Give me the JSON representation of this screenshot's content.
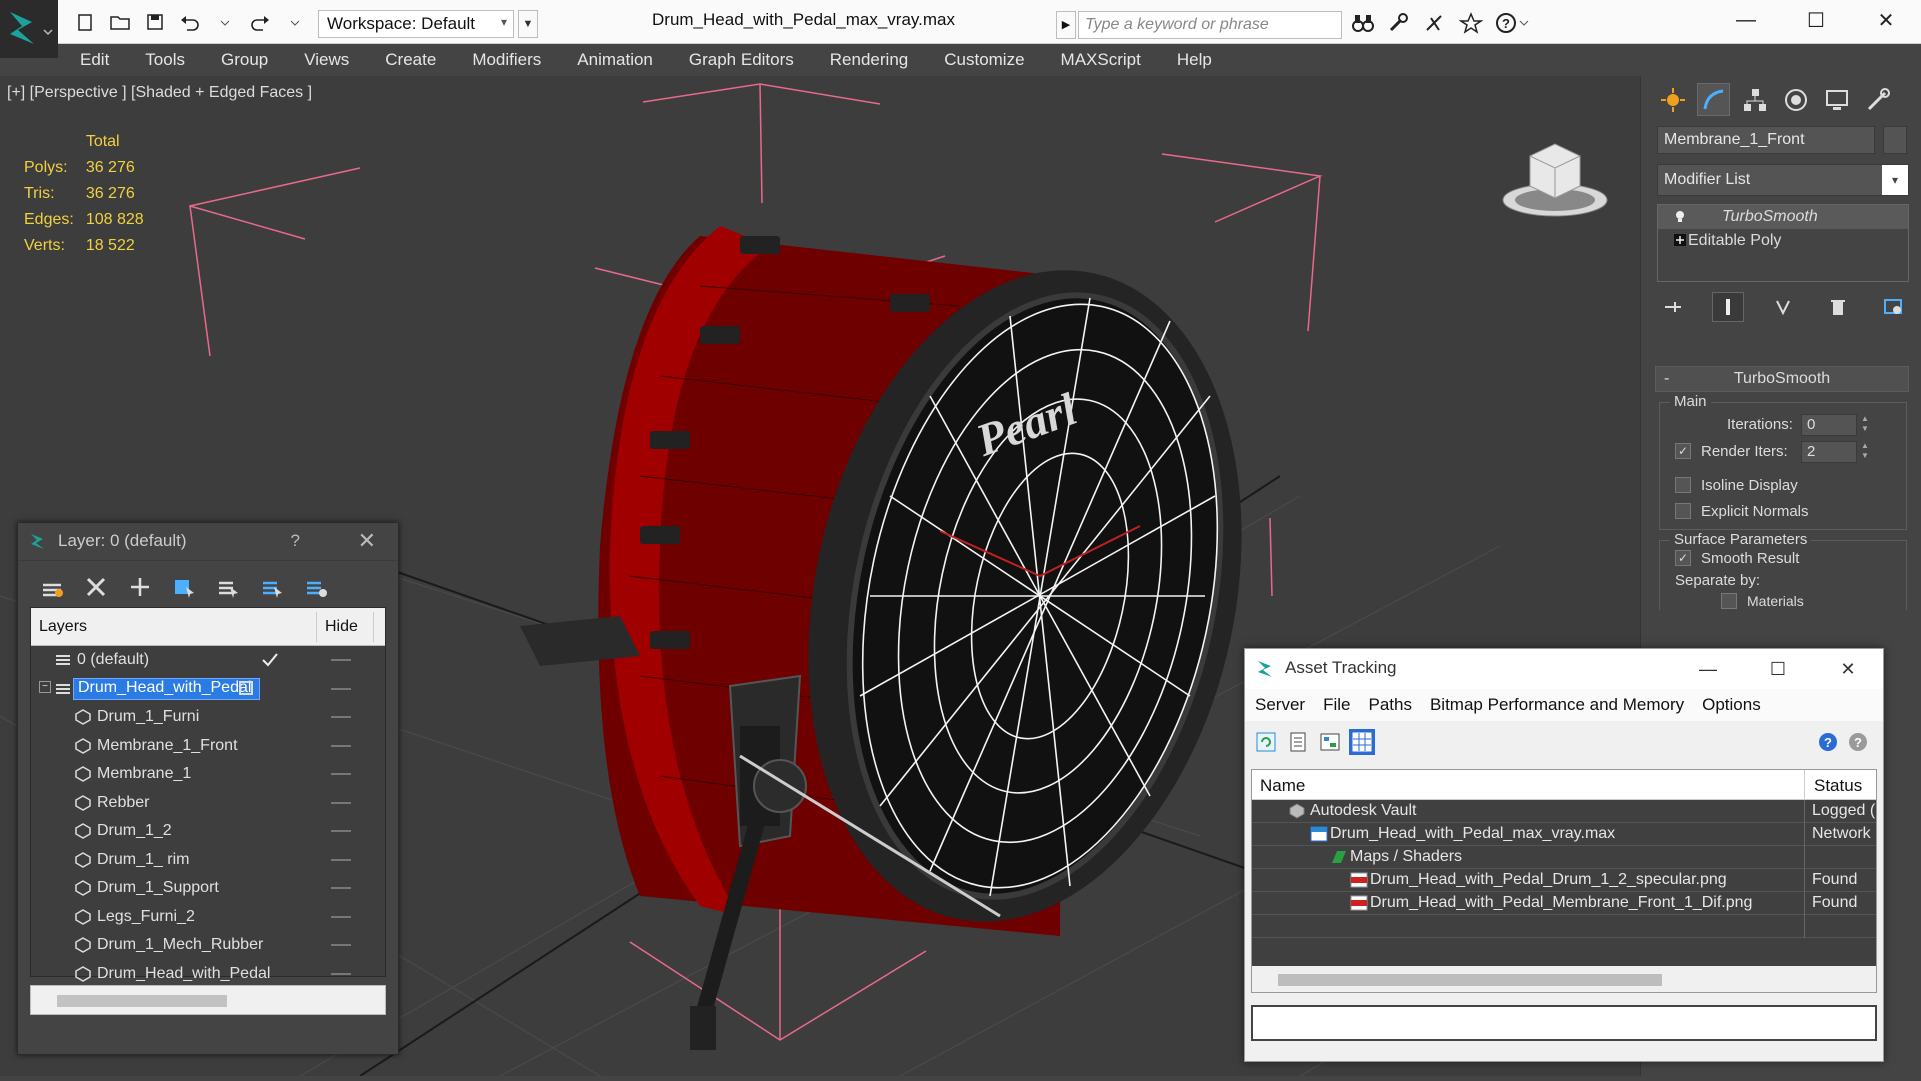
{
  "titlebar": {
    "workspace_label": "Workspace: Default",
    "document_title": "Drum_Head_with_Pedal_max_vray.max",
    "search_placeholder": "Type a keyword or phrase"
  },
  "menu": [
    "Edit",
    "Tools",
    "Group",
    "Views",
    "Create",
    "Modifiers",
    "Animation",
    "Graph Editors",
    "Rendering",
    "Customize",
    "MAXScript",
    "Help"
  ],
  "viewport": {
    "label": "[+] [Perspective ] [Shaded + Edged Faces ]",
    "stats_header": "Total",
    "stats": [
      {
        "label": "Polys:",
        "value": "36 276"
      },
      {
        "label": "Tris:",
        "value": "36 276"
      },
      {
        "label": "Edges:",
        "value": "108 828"
      },
      {
        "label": "Verts:",
        "value": "18 522"
      }
    ],
    "drum_logo": "Pearl"
  },
  "command_panel": {
    "object_name": "Membrane_1_Front",
    "modifier_list": "Modifier List",
    "stack": [
      "TurboSmooth",
      "Editable Poly"
    ],
    "rollout_title": "TurboSmooth",
    "main_group": "Main",
    "iterations_label": "Iterations:",
    "iterations_value": "0",
    "render_iters_label": "Render Iters:",
    "render_iters_value": "2",
    "isoline_label": "Isoline Display",
    "explicit_normals_label": "Explicit Normals",
    "surface_group": "Surface Parameters",
    "smooth_result_label": "Smooth Result",
    "separate_by_label": "Separate by:",
    "materials_label": "Materials"
  },
  "layer_dialog": {
    "title": "Layer: 0 (default)",
    "help": "?",
    "col_layers": "Layers",
    "col_hide": "Hide",
    "rows": [
      {
        "label": "0 (default)",
        "indent": 0
      },
      {
        "label": "Drum_Head_with_Pedal",
        "indent": 0
      },
      {
        "label": "Drum_1_Furni",
        "indent": 1
      },
      {
        "label": "Membrane_1_Front",
        "indent": 1
      },
      {
        "label": "Membrane_1",
        "indent": 1
      },
      {
        "label": "Rebber",
        "indent": 1
      },
      {
        "label": "Drum_1_2",
        "indent": 1
      },
      {
        "label": "Drum_1_ rim",
        "indent": 1
      },
      {
        "label": "Drum_1_Support",
        "indent": 1
      },
      {
        "label": "Legs_Furni_2",
        "indent": 1
      },
      {
        "label": "Drum_1_Mech_Rubber",
        "indent": 1
      },
      {
        "label": "Drum_Head_with_Pedal",
        "indent": 1
      }
    ]
  },
  "asset_dialog": {
    "title": "Asset Tracking",
    "menu": [
      "Server",
      "File",
      "Paths",
      "Bitmap Performance and Memory",
      "Options"
    ],
    "col_name": "Name",
    "col_status": "Status",
    "rows": [
      {
        "label": "Autodesk Vault",
        "status": "Logged (",
        "indent": 0
      },
      {
        "label": "Drum_Head_with_Pedal_max_vray.max",
        "status": "Network",
        "indent": 1
      },
      {
        "label": "Maps / Shaders",
        "status": "",
        "indent": 2
      },
      {
        "label": "Drum_Head_with_Pedal_Drum_1_2_specular.png",
        "status": "Found",
        "indent": 3
      },
      {
        "label": "Drum_Head_with_Pedal_Membrane_Front_1_Dif.png",
        "status": "Found",
        "indent": 3
      }
    ]
  }
}
